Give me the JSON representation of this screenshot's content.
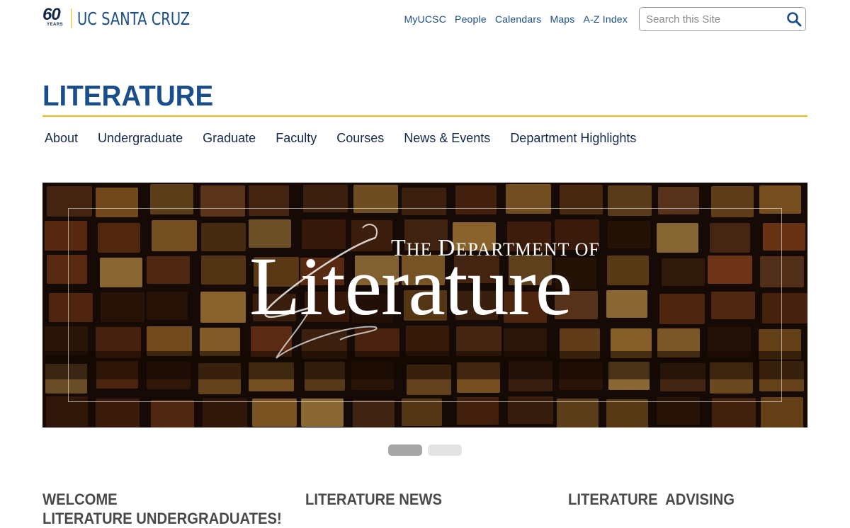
{
  "logo": {
    "anniversary_number": "60",
    "anniversary_label": "YEARS",
    "wordmark": "UC SANTA CRUZ"
  },
  "utility_nav": [
    {
      "label": "MyUCSC"
    },
    {
      "label": "People"
    },
    {
      "label": "Calendars"
    },
    {
      "label": "Maps"
    },
    {
      "label": "A-Z Index"
    }
  ],
  "search": {
    "placeholder": "Search this Site",
    "value": ""
  },
  "site": {
    "title": "LITERATURE"
  },
  "main_nav": [
    {
      "label": "About"
    },
    {
      "label": "Undergraduate"
    },
    {
      "label": "Graduate"
    },
    {
      "label": "Faculty"
    },
    {
      "label": "Courses"
    },
    {
      "label": "News & Events"
    },
    {
      "label": "Department Highlights"
    }
  ],
  "hero": {
    "kicker_the": "T",
    "kicker_rest1": "HE ",
    "kicker_d": "D",
    "kicker_rest2": "EPARTMENT OF",
    "title": "Literature",
    "slides_total": 2,
    "active_slide": 1
  },
  "sections": {
    "welcome_line1": "WELCOME",
    "welcome_line2": "LITERATURE UNDERGRADUATES!",
    "news": "LITERATURE NEWS",
    "advising": "LITERATURE  ADVISING"
  },
  "colors": {
    "brand_blue": "#1a4e8a",
    "navy": "#13294b",
    "gold": "#f2b90f"
  }
}
